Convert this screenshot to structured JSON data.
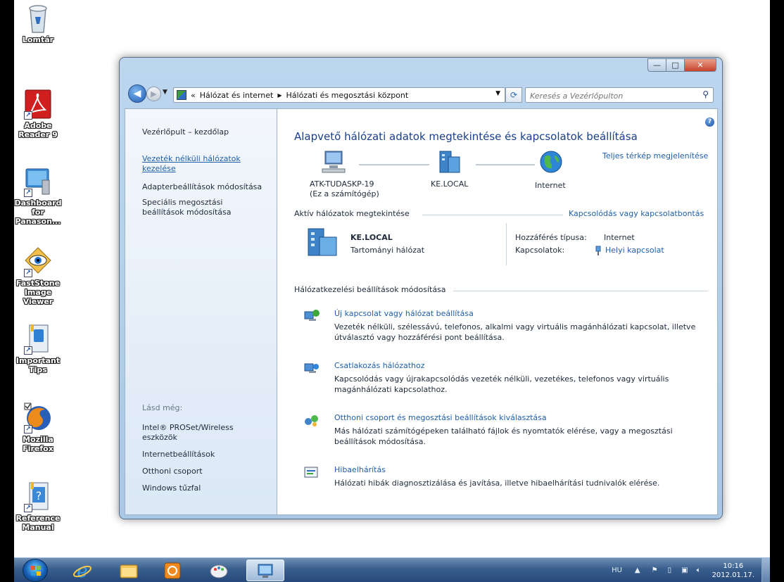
{
  "desktop": {
    "icons": [
      {
        "label": "Lomtár"
      },
      {
        "label": "Adobe Reader 9"
      },
      {
        "label": "Dashboard for Panason..."
      },
      {
        "label": "FastStone Image Viewer"
      },
      {
        "label": "Important Tips"
      },
      {
        "label": "Mozilla Firefox"
      },
      {
        "label": "Reference Manual"
      }
    ]
  },
  "window": {
    "buttons": {
      "minimize": "—",
      "maximize": "□",
      "close": "✕"
    },
    "address": {
      "overflow": "«",
      "segments": [
        "Hálózat és internet",
        "Hálózati és megosztási központ"
      ]
    },
    "search_placeholder": "Keresés a Vezérlőpulton"
  },
  "left_pane": {
    "home": "Vezérlőpult – kezdőlap",
    "tasks": [
      "Vezeték nélküli hálózatok kezelése",
      "Adapterbeállítások módosítása",
      "Speciális megosztási beállítások módosítása"
    ],
    "see_also_title": "Lásd még:",
    "see_also": [
      "Intel® PROSet/Wireless eszközök",
      "Internetbeállítások",
      "Otthoni csoport",
      "Windows tűzfal"
    ]
  },
  "main": {
    "title": "Alapvető hálózati adatok megtekintése és kapcsolatok beállítása",
    "full_map_link": "Teljes térkép megjelenítése",
    "map": {
      "computer_name": "ATK-TUDASKP-19",
      "computer_sub": "(Ez a számítógép)",
      "network_name": "KE.LOCAL",
      "internet": "Internet"
    },
    "active_networks": {
      "title": "Aktív hálózatok megtekintése",
      "connect_link": "Kapcsolódás vagy kapcsolatbontás",
      "network_name": "KE.LOCAL",
      "network_type": "Tartományi hálózat",
      "access_type_label": "Hozzáférés típusa:",
      "access_type_value": "Internet",
      "connections_label": "Kapcsolatok:",
      "connections_value": "Helyi kapcsolat"
    },
    "settings": {
      "title": "Hálózatkezelési beállítások módosítása",
      "tasks": [
        {
          "link": "Új kapcsolat vagy hálózat beállítása",
          "desc": "Vezeték nélküli, szélessávú, telefonos, alkalmi vagy virtuális magánhálózati kapcsolat, illetve útválasztó vagy hozzáférési pont beállítása."
        },
        {
          "link": "Csatlakozás hálózathoz",
          "desc": "Kapcsolódás vagy újrakapcsolódás vezeték nélküli, vezetékes, telefonos vagy virtuális magánhálózati kapcsolathoz."
        },
        {
          "link": "Otthoni csoport és megosztási beállítások kiválasztása",
          "desc": "Más hálózati számítógépeken található fájlok és nyomtatók elérése, vagy a megosztási beállítások módosítása."
        },
        {
          "link": "Hibaelhárítás",
          "desc": "Hálózati hibák diagnosztizálása és javítása, illetve hibaelhárítási tudnivalók elérése."
        }
      ]
    }
  },
  "taskbar": {
    "language": "HU",
    "time": "10:16",
    "date": "2012.01.17."
  },
  "colors": {
    "link": "#1f5faa",
    "title": "#1a3f8a",
    "taskbar": "#2f558a"
  }
}
